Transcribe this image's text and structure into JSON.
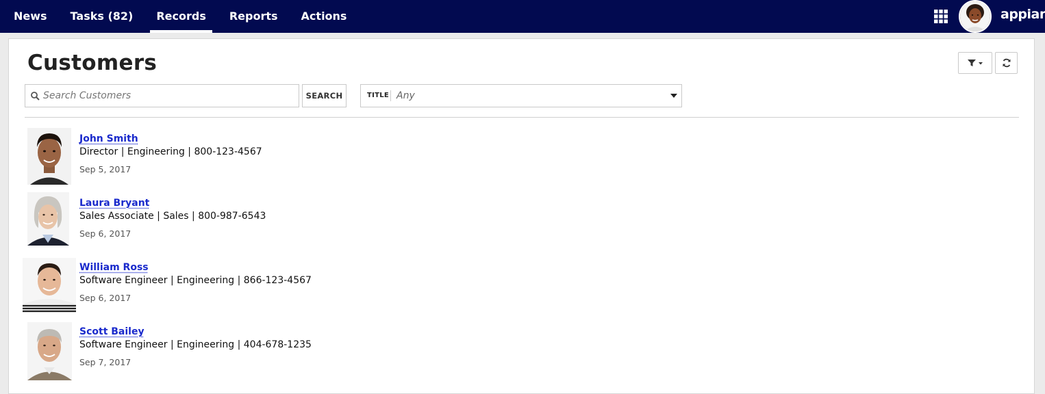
{
  "nav": {
    "items": [
      {
        "label": "News",
        "active": false
      },
      {
        "label": "Tasks (82)",
        "active": false
      },
      {
        "label": "Records",
        "active": true
      },
      {
        "label": "Reports",
        "active": false
      },
      {
        "label": "Actions",
        "active": false
      }
    ],
    "brand": "appian",
    "icons": [
      "apps-grid-icon",
      "user-avatar"
    ]
  },
  "page": {
    "title": "Customers"
  },
  "toolbar": {
    "icons": [
      "filter-icon",
      "refresh-icon"
    ]
  },
  "search": {
    "placeholder": "Search Customers",
    "value": "",
    "button_label": "SEARCH"
  },
  "filter": {
    "label": "TITLE",
    "value": "Any"
  },
  "customers": [
    {
      "name": "John Smith",
      "details": "Director | Engineering | 800-123-4567",
      "date": "Sep 5, 2017"
    },
    {
      "name": "Laura Bryant",
      "details": "Sales Associate | Sales | 800-987-6543",
      "date": "Sep 6, 2017"
    },
    {
      "name": "William Ross",
      "details": "Software Engineer | Engineering | 866-123-4567",
      "date": "Sep 6, 2017"
    },
    {
      "name": "Scott Bailey",
      "details": "Software Engineer | Engineering | 404-678-1235",
      "date": "Sep 7, 2017"
    }
  ],
  "colors": {
    "nav_background": "#020a50",
    "link": "#1a2acc"
  }
}
